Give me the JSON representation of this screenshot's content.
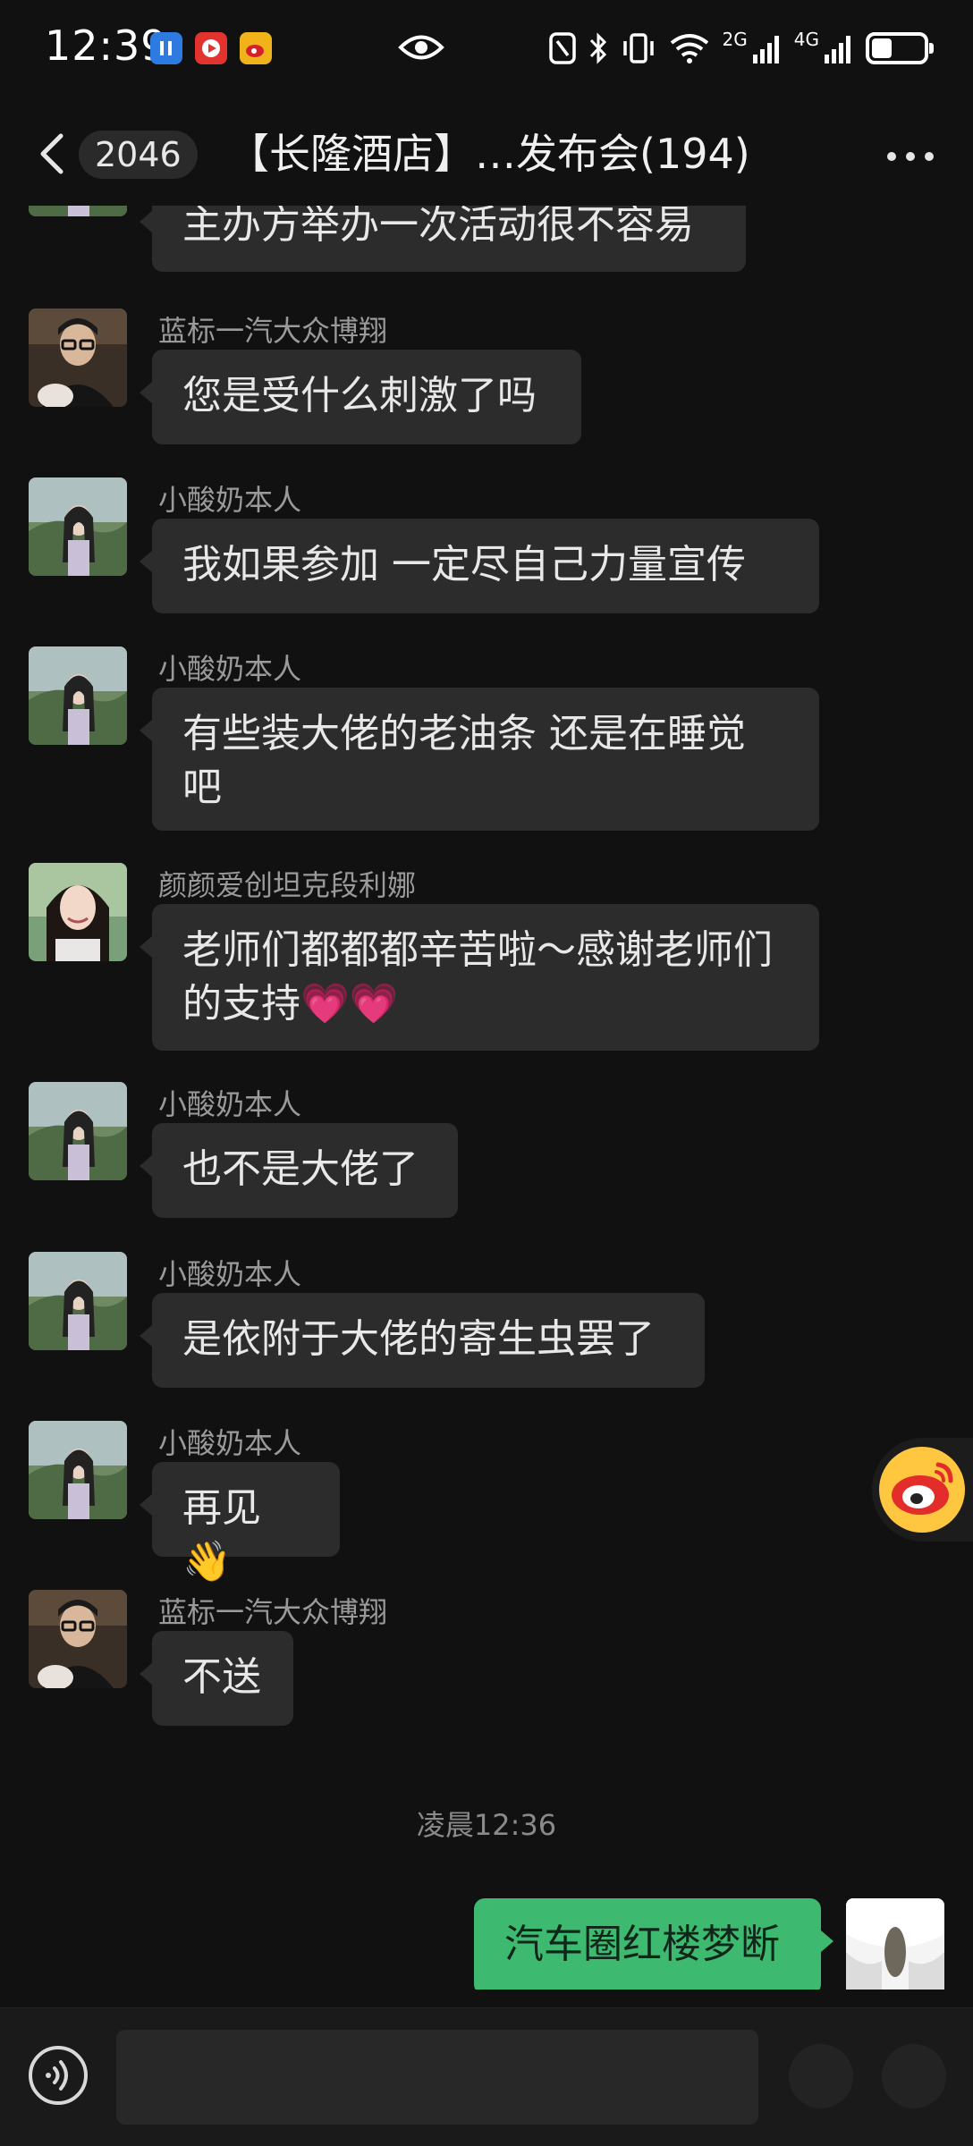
{
  "status_bar": {
    "time": "12:39",
    "network_2g": "2G",
    "network_4g": "4G"
  },
  "nav": {
    "unread_count": "2046",
    "title": "【长隆酒店】…发布会(194)"
  },
  "messages": [
    {
      "sender": "",
      "text": "主办方举办一次活动很不容易",
      "avatar": "woman-landscape"
    },
    {
      "sender": "蓝标一汽大众博翔",
      "text": "您是受什么刺激了吗",
      "avatar": "man-glasses"
    },
    {
      "sender": "小酸奶本人",
      "text": "我如果参加 一定尽自己力量宣传",
      "avatar": "woman-landscape"
    },
    {
      "sender": "小酸奶本人",
      "text_line1": "有些装大佬的老油条  还是在睡觉",
      "text_line2": "吧",
      "avatar": "woman-landscape"
    },
    {
      "sender": "颜颜爱创坦克段利娜",
      "text_line1": "老师们都都都辛苦啦～感谢老师们",
      "text_line2": "的支持💗💗",
      "avatar": "woman-smile"
    },
    {
      "sender": "小酸奶本人",
      "text": "也不是大佬了",
      "avatar": "woman-landscape"
    },
    {
      "sender": "小酸奶本人",
      "text": "是依附于大佬的寄生虫罢了",
      "avatar": "woman-landscape"
    },
    {
      "sender": "小酸奶本人",
      "text": "再见👋",
      "avatar": "woman-landscape"
    },
    {
      "sender": "蓝标一汽大众博翔",
      "text": "不送",
      "avatar": "man-glasses"
    }
  ],
  "timestamp": "凌晨12:36",
  "own_message": {
    "text": "汽车圈红楼梦断"
  },
  "colors": {
    "background": "#111111",
    "bubble": "#2c2c2c",
    "own_bubble": "#3eb970",
    "sender_text": "#9a9a9a"
  },
  "icons": {
    "back": "chevron-left-icon",
    "more": "more-dots-icon",
    "voice": "voice-icon",
    "emoji": "emoji-icon",
    "plus": "plus-icon",
    "float": "weibo-icon"
  }
}
